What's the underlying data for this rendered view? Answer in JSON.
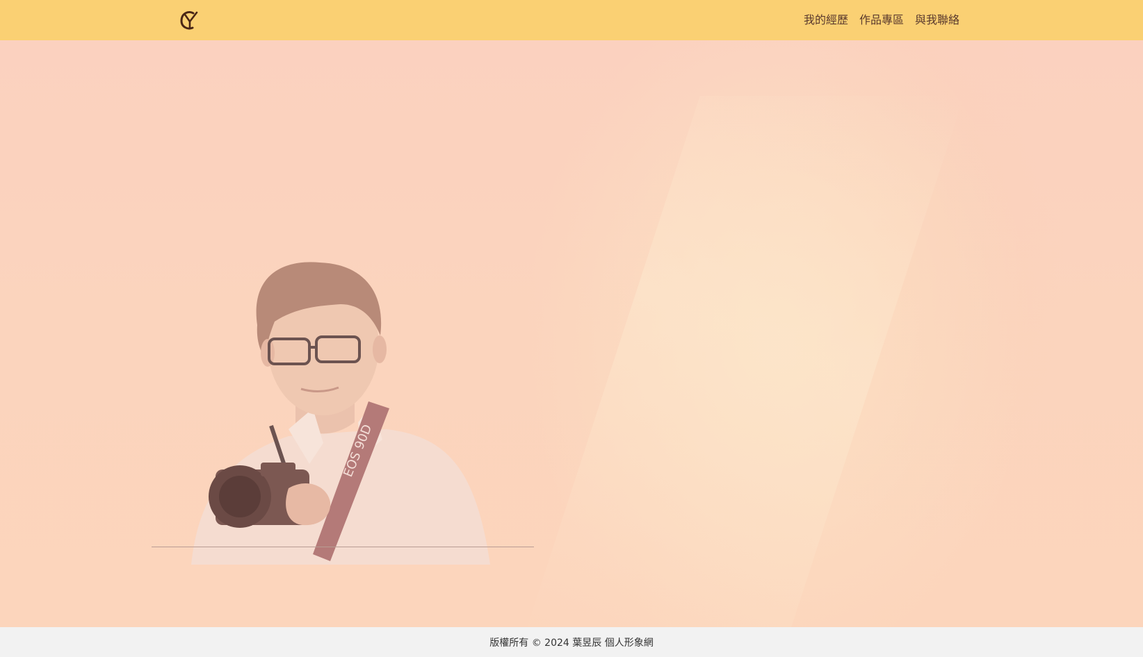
{
  "header": {
    "logo_icon": "yc-monogram-logo",
    "nav": [
      {
        "label": "我的經歷"
      },
      {
        "label": "作品專區"
      },
      {
        "label": "與我聯絡"
      }
    ]
  },
  "hero": {
    "image": "portrait-man-with-camera",
    "camera_strap_text": "EOS 90D"
  },
  "footer": {
    "copyright": "版權所有 © 2024 葉昱辰 個人形象網"
  },
  "colors": {
    "header_bg": "#fad073",
    "hero_bg": "#fbd2bd",
    "footer_bg": "#f2f2f2",
    "nav_text": "#5a3a2e"
  }
}
